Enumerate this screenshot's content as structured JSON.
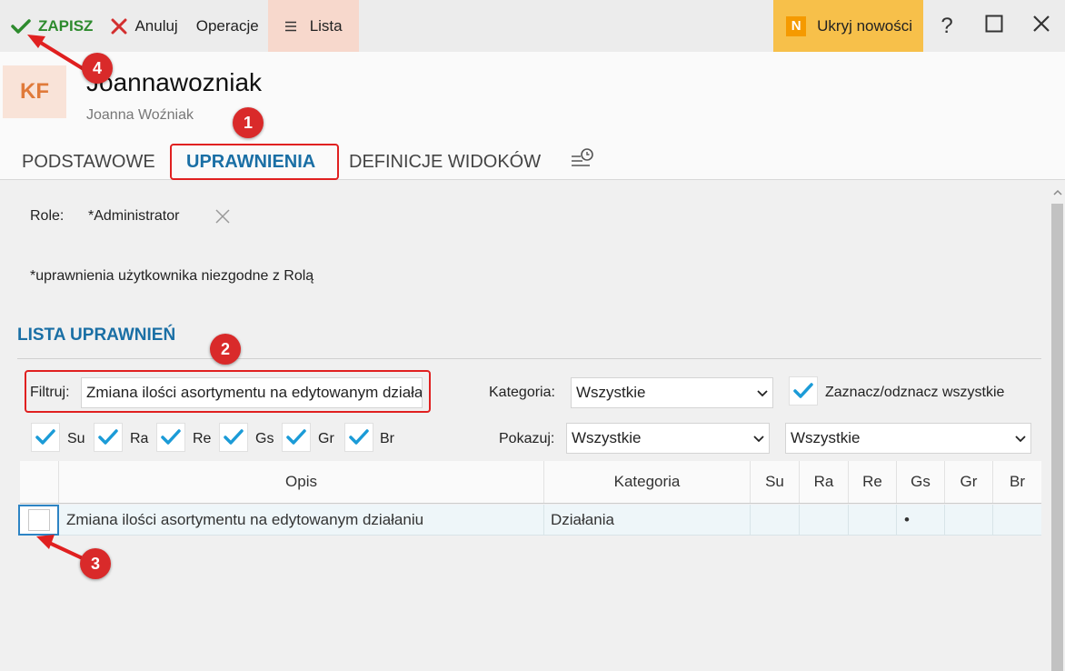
{
  "toolbar": {
    "save_label": "ZAPISZ",
    "cancel_label": "Anuluj",
    "operations_label": "Operacje",
    "list_label": "Lista",
    "news_badge": "N",
    "news_label": "Ukryj nowości",
    "help_label": "?",
    "colors": {
      "save": "#2e8b2e",
      "cancel": "#d32f2f",
      "news_bg": "#f7c04a",
      "list_bg": "#f7d8cc"
    }
  },
  "header": {
    "avatar_initials": "KF",
    "username": "Joannawozniak",
    "full_name": "Joanna Woźniak"
  },
  "tabs": [
    {
      "label": "PODSTAWOWE",
      "active": false
    },
    {
      "label": "UPRAWNIENIA",
      "active": true
    },
    {
      "label": "DEFINICJE WIDOKÓW",
      "active": false
    }
  ],
  "roles": {
    "label": "Role:",
    "value": "*Administrator"
  },
  "note": "*uprawnienia użytkownika niezgodne z Rolą",
  "section": {
    "title": "LISTA UPRAWNIEŃ"
  },
  "filter": {
    "label": "Filtruj:",
    "value": "Zmiana ilości asortymentu na edytowanym działaniu"
  },
  "category": {
    "label": "Kategoria:",
    "value": "Wszystkie"
  },
  "toggle_all": {
    "label": "Zaznacz/odznacz wszystkie",
    "checked": true
  },
  "show": {
    "label": "Pokazuj:",
    "value1": "Wszystkie",
    "value2": "Wszystkie"
  },
  "flags": [
    {
      "label": "Su",
      "checked": true
    },
    {
      "label": "Ra",
      "checked": true
    },
    {
      "label": "Re",
      "checked": true
    },
    {
      "label": "Gs",
      "checked": true
    },
    {
      "label": "Gr",
      "checked": true
    },
    {
      "label": "Br",
      "checked": true
    }
  ],
  "table": {
    "columns": [
      "Opis",
      "Kategoria",
      "Su",
      "Ra",
      "Re",
      "Gs",
      "Gr",
      "Br"
    ],
    "rows": [
      {
        "checked": false,
        "opis": "Zmiana ilości asortymentu na edytowanym działaniu",
        "kategoria": "Działania",
        "gs": "•"
      }
    ]
  },
  "annotations": [
    "1",
    "2",
    "3",
    "4"
  ],
  "accent_color": "#1a6fa5",
  "check_color": "#1b9bd7",
  "annotation_color": "#d92a2a"
}
